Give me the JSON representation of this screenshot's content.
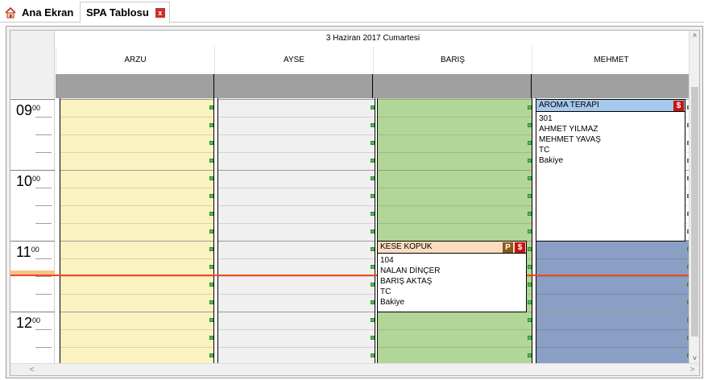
{
  "tabs": [
    {
      "label": "Ana Ekran",
      "icon": "home-icon"
    },
    {
      "label": "SPA Tablosu",
      "close_label": "x"
    }
  ],
  "calendar": {
    "date_title": "3 Haziran 2017 Cumartesi",
    "minute_label": "00",
    "hours": [
      "09",
      "10",
      "11",
      "12"
    ],
    "resources": [
      {
        "name": "ARZU",
        "color": "#fbf2c2"
      },
      {
        "name": "AYSE",
        "color": "#f0f0f0"
      },
      {
        "name": "BARIŞ",
        "color": "#b2d697"
      },
      {
        "name": "MEHMET",
        "color": "#8b9fc4"
      }
    ],
    "mehmet_free_color": "#ffffff"
  },
  "appointments": [
    {
      "title": "AROMA TERAPI",
      "header_color": "#a6c9ec",
      "room": "301",
      "customer": "AHMET YILMAZ",
      "therapist": "MEHMET YAVAŞ",
      "id_type": "TC",
      "balance_label": "Bakiye",
      "badges": [
        "$"
      ]
    },
    {
      "title": "KESE KOPUK",
      "header_color": "#fcdcc0",
      "room": "104",
      "customer": "NALAN DİNÇER",
      "therapist": "BARIŞ AKTAŞ",
      "id_type": "TC",
      "balance_label": "Bakiye",
      "badges": [
        "P",
        "$"
      ]
    }
  ],
  "scrollbars": {
    "up": "˄",
    "down": "˅",
    "left": "<",
    "right": ">"
  }
}
